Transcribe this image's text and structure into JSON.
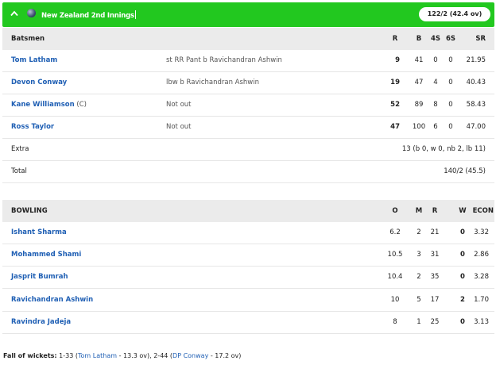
{
  "header": {
    "team": "New Zealand 2nd Innings",
    "score": "122/2 (42.4 ov)"
  },
  "batting": {
    "columns": {
      "batsman": "Batsmen",
      "r": "R",
      "b": "B",
      "fours": "4S",
      "sixes": "6S",
      "sr": "SR"
    },
    "rows": [
      {
        "name": "Tom Latham",
        "dismissal": "st RR Pant b Ravichandran Ashwin",
        "r": "9",
        "b": "41",
        "fours": "0",
        "sixes": "0",
        "sr": "21.95"
      },
      {
        "name": "Devon Conway",
        "dismissal": "lbw b Ravichandran Ashwin",
        "r": "19",
        "b": "47",
        "fours": "4",
        "sixes": "0",
        "sr": "40.43"
      },
      {
        "name": "Kane Williamson",
        "captain": "(C)",
        "dismissal": "Not out",
        "r": "52",
        "b": "89",
        "fours": "8",
        "sixes": "0",
        "sr": "58.43"
      },
      {
        "name": "Ross Taylor",
        "dismissal": "Not out",
        "r": "47",
        "b": "100",
        "fours": "6",
        "sixes": "0",
        "sr": "47.00"
      }
    ],
    "extras": {
      "label": "Extra",
      "value": "13 (b 0, w 0, nb 2, lb 11)"
    },
    "total": {
      "label": "Total",
      "value": "140/2 (45.5)"
    }
  },
  "bowling": {
    "columns": {
      "bowler": "BOWLING",
      "o": "O",
      "m": "M",
      "r": "R",
      "w": "W",
      "econ": "ECON"
    },
    "rows": [
      {
        "name": "Ishant Sharma",
        "o": "6.2",
        "m": "2",
        "r": "21",
        "w": "0",
        "econ": "3.32"
      },
      {
        "name": "Mohammed Shami",
        "o": "10.5",
        "m": "3",
        "r": "31",
        "w": "0",
        "econ": "2.86"
      },
      {
        "name": "Jasprit Bumrah",
        "o": "10.4",
        "m": "2",
        "r": "35",
        "w": "0",
        "econ": "3.28"
      },
      {
        "name": "Ravichandran Ashwin",
        "o": "10",
        "m": "5",
        "r": "17",
        "w": "2",
        "econ": "1.70"
      },
      {
        "name": "Ravindra Jadeja",
        "o": "8",
        "m": "1",
        "r": "25",
        "w": "0",
        "econ": "3.13"
      }
    ]
  },
  "fall_of_wickets": {
    "label": "Fall of wickets:",
    "w1_score": "1-33",
    "w1_player": "Tom Latham",
    "w1_over": "- 13.3 ov",
    "w2_score": "2-44",
    "w2_player": "DP Conway",
    "w2_over": "- 17.2 ov"
  },
  "colors": {
    "header_bg": "#22c81f",
    "link": "#1f5fb4",
    "row_header_bg": "#ebebeb"
  },
  "icons": {
    "collapse": "chevron-up-icon",
    "team": "team-ball-icon"
  }
}
